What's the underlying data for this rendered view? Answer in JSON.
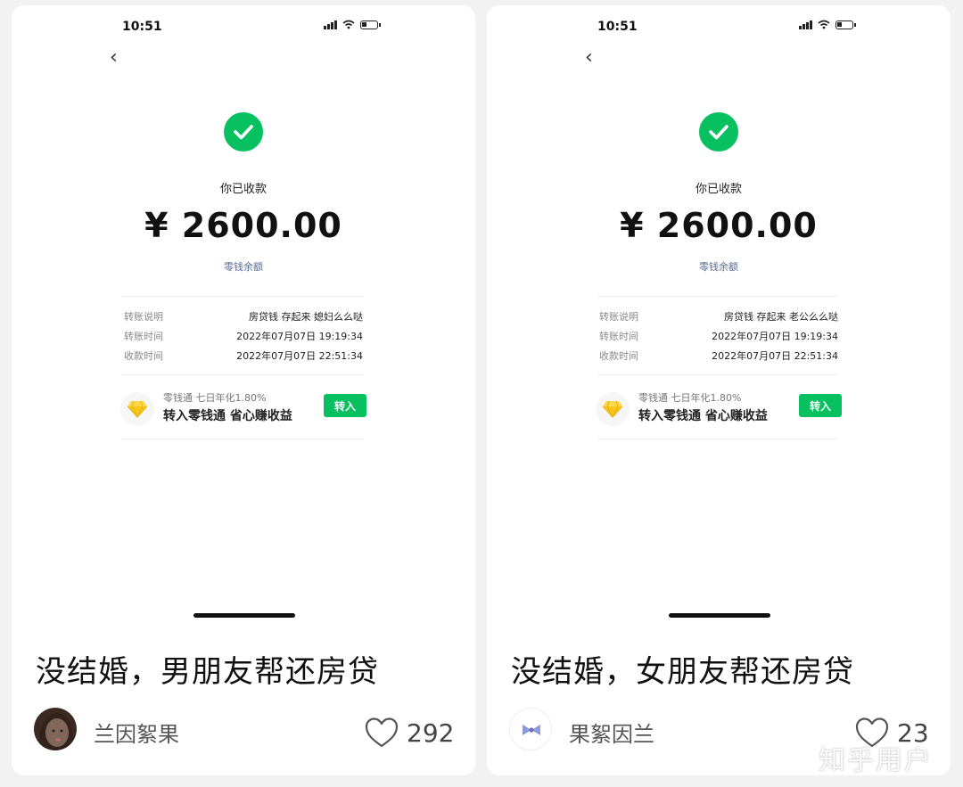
{
  "cards": [
    {
      "status_time": "10:51",
      "received_label": "你已收款",
      "amount": "¥ 2600.00",
      "balance_link": "零钱余额",
      "details": [
        {
          "label": "转账说明",
          "value": "房贷钱 存起来 媳妇么么哒"
        },
        {
          "label": "转账时间",
          "value": "2022年07月07日 19:19:34"
        },
        {
          "label": "收款时间",
          "value": "2022年07月07日 22:51:34"
        }
      ],
      "promo_sub": "零钱通 七日年化1.80%",
      "promo_main": "转入零钱通 省心赚收益",
      "promo_button": "转入",
      "title": "没结婚，男朋友帮还房贷",
      "author": "兰因絮果",
      "likes": "292"
    },
    {
      "status_time": "10:51",
      "received_label": "你已收款",
      "amount": "¥ 2600.00",
      "balance_link": "零钱余额",
      "details": [
        {
          "label": "转账说明",
          "value": "房贷钱 存起来 老公么么哒"
        },
        {
          "label": "转账时间",
          "value": "2022年07月07日 19:19:34"
        },
        {
          "label": "收款时间",
          "value": "2022年07月07日 22:51:34"
        }
      ],
      "promo_sub": "零钱通 七日年化1.80%",
      "promo_main": "转入零钱通 省心赚收益",
      "promo_button": "转入",
      "title": "没结婚，女朋友帮还房贷",
      "author": "果絮因兰",
      "likes": "23"
    }
  ],
  "watermark": "知乎用户",
  "colors": {
    "wechat_green": "#07c160",
    "link_blue": "#576b95"
  },
  "icons": [
    "back-icon",
    "check-icon",
    "diamond-icon",
    "heart-icon",
    "avatar-photo",
    "bow-avatar"
  ]
}
